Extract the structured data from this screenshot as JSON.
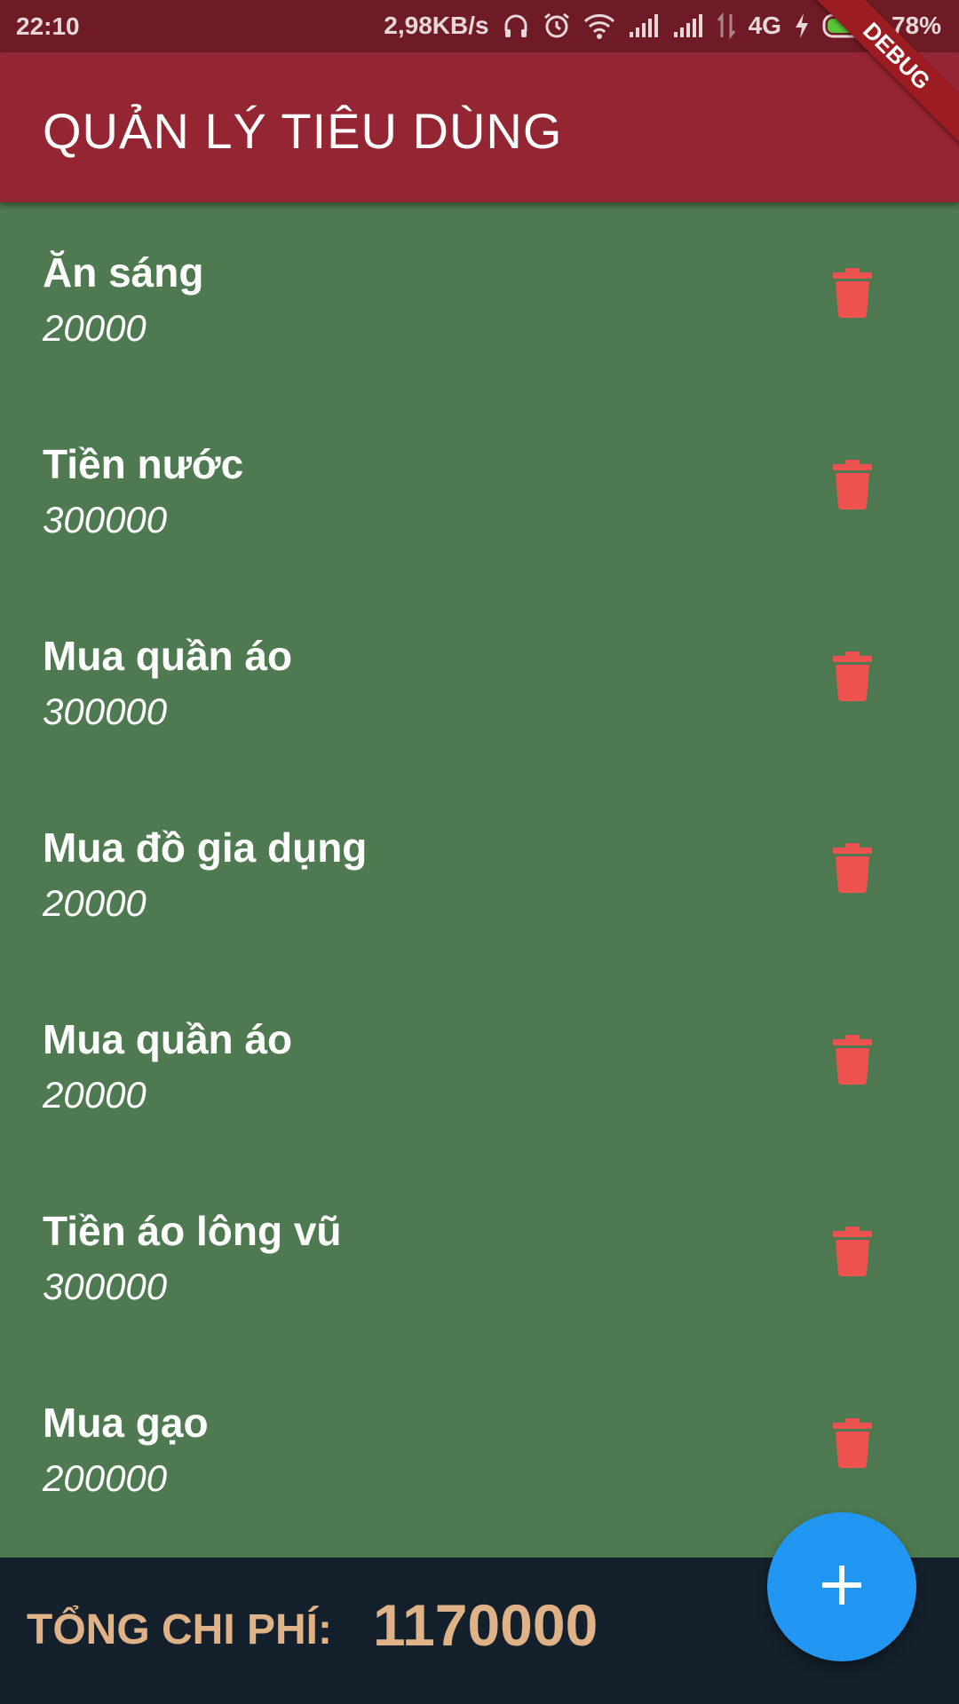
{
  "status_bar": {
    "time": "22:10",
    "network_speed": "2,98KB/s",
    "network_type": "4G",
    "battery": "78%",
    "battery_level": 0.78,
    "icons": [
      "headphones-icon",
      "alarm-icon",
      "wifi-icon",
      "signal-icon",
      "signal-icon",
      "data-transfer-icon",
      "charging-icon",
      "battery-icon"
    ]
  },
  "app_bar": {
    "title": "QUẢN LÝ TIÊU DÙNG",
    "debug_banner": "DEBUG"
  },
  "expenses": [
    {
      "name": "Ăn sáng",
      "amount": "20000"
    },
    {
      "name": "Tiền nước",
      "amount": "300000"
    },
    {
      "name": "Mua quần áo",
      "amount": "300000"
    },
    {
      "name": "Mua đồ gia dụng",
      "amount": "20000"
    },
    {
      "name": "Mua quần áo",
      "amount": "20000"
    },
    {
      "name": "Tiền áo lông vũ",
      "amount": "300000"
    },
    {
      "name": "Mua gạo",
      "amount": "200000"
    }
  ],
  "footer": {
    "total_label": "TỔNG CHI PHÍ:",
    "total_value": "1170000"
  },
  "fab": {
    "icon": "plus-icon"
  },
  "colors": {
    "status_bar": "#6e1b25",
    "app_bar": "#942532",
    "list_background": "#4f7a51",
    "delete_icon": "#ef5350",
    "footer": "#14212c",
    "total_text": "#e0b287",
    "fab": "#2196f3"
  }
}
